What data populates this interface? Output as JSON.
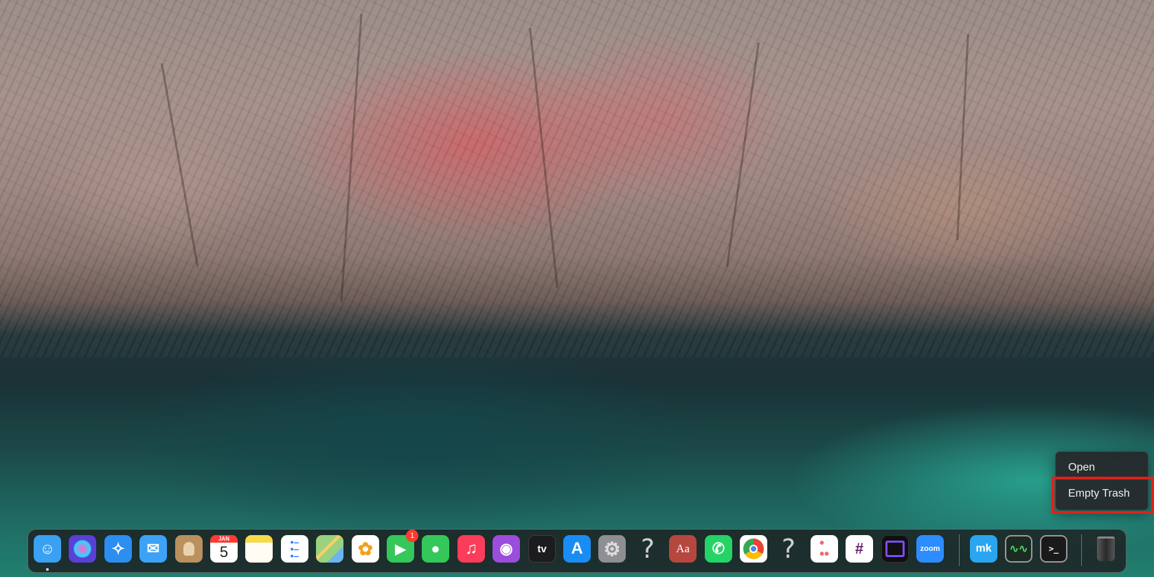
{
  "context_menu": {
    "items": [
      {
        "label": "Open"
      },
      {
        "label": "Empty Trash"
      }
    ]
  },
  "dock": {
    "apps": [
      {
        "name": "Finder",
        "icon": "finder-icon",
        "color": "#3aa0f2",
        "running": true
      },
      {
        "name": "Siri",
        "icon": "siri-icon",
        "color": "#5a3fd8"
      },
      {
        "name": "Safari",
        "icon": "safari-icon",
        "color": "#2b8ef0"
      },
      {
        "name": "Mail",
        "icon": "mail-icon",
        "color": "#3da2f5"
      },
      {
        "name": "Contacts",
        "icon": "contacts-icon",
        "color": "#b9905e"
      },
      {
        "name": "Calendar",
        "icon": "calendar-icon",
        "color": "#ffffff",
        "month": "JAN",
        "day": "5"
      },
      {
        "name": "Notes",
        "icon": "notes-icon",
        "color": "#f7d94c"
      },
      {
        "name": "Reminders",
        "icon": "reminders-icon",
        "color": "#ffffff"
      },
      {
        "name": "Maps",
        "icon": "maps-icon",
        "color": "#6fc26a"
      },
      {
        "name": "Photos",
        "icon": "photos-icon",
        "color": "#ffffff"
      },
      {
        "name": "FaceTime",
        "icon": "facetime-icon",
        "color": "#34c759",
        "badge": "1"
      },
      {
        "name": "Messages",
        "icon": "messages-icon",
        "color": "#34c759"
      },
      {
        "name": "Music",
        "icon": "music-icon",
        "color": "#fb3c5a"
      },
      {
        "name": "Podcasts",
        "icon": "podcasts-icon",
        "color": "#9b4ddb"
      },
      {
        "name": "TV",
        "icon": "apple-tv-icon",
        "color": "#1c1c1e",
        "label": "tv"
      },
      {
        "name": "App Store",
        "icon": "app-store-icon",
        "color": "#1a8df5"
      },
      {
        "name": "System Preferences",
        "icon": "system-preferences-icon",
        "color": "#8e8e93"
      },
      {
        "name": "Unknown App",
        "icon": "question-mark-icon",
        "color": "transparent"
      },
      {
        "name": "Dictionary",
        "icon": "dictionary-icon",
        "color": "#b5473f",
        "label": "Aa"
      },
      {
        "name": "WhatsApp",
        "icon": "whatsapp-icon",
        "color": "#25d366"
      },
      {
        "name": "Chrome",
        "icon": "chrome-icon",
        "color": "#ffffff"
      },
      {
        "name": "Unknown App",
        "icon": "question-mark-icon",
        "color": "transparent"
      },
      {
        "name": "Asana",
        "icon": "asana-icon",
        "color": "#ffffff"
      },
      {
        "name": "Slack",
        "icon": "slack-icon",
        "color": "#ffffff"
      },
      {
        "name": "Screen Capture",
        "icon": "screen-capture-icon",
        "color": "#101010"
      },
      {
        "name": "Zoom",
        "icon": "zoom-icon",
        "color": "#2d8cff",
        "label": "zoom"
      }
    ],
    "utilities": [
      {
        "name": "MK",
        "icon": "mk-icon",
        "color": "#2aa6f0",
        "label": "mk"
      },
      {
        "name": "Activity Monitor",
        "icon": "activity-monitor-icon",
        "color": "#1c2a24"
      },
      {
        "name": "Terminal",
        "icon": "terminal-icon",
        "color": "#1a1a1a",
        "label": ">_"
      }
    ],
    "trash": {
      "name": "Trash",
      "icon": "trash-icon"
    }
  }
}
